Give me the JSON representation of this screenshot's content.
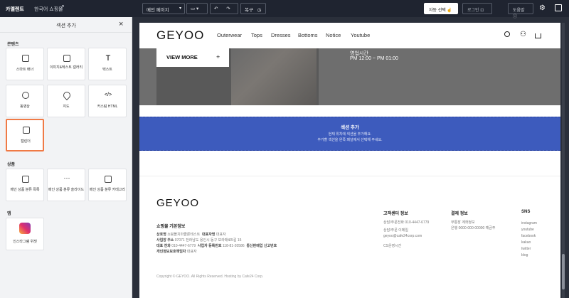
{
  "topbar": {
    "brand": "카멜렌트",
    "shop": "한국어 쇼핑몰",
    "page_select": "메인 페이지",
    "restore_label": "복구",
    "auto_select_label": "자동 선택",
    "login_label": "로그인",
    "help_label": "도움말"
  },
  "panel": {
    "title": "섹션 추가",
    "categories": {
      "content": "콘텐츠",
      "product": "상품",
      "app": "앱"
    },
    "content_tiles": [
      "스마트 배너",
      "이미지&텍스트 갤러리",
      "텍스트",
      "동영상",
      "지도",
      "커스텀 HTML",
      "캘린더"
    ],
    "product_tiles": [
      "메인 상품 분류 목록",
      "메인 상품 분류 슬라이드",
      "메인 상품 분류 카테고리"
    ],
    "app_tiles": [
      "인스타그램 위젯"
    ]
  },
  "site": {
    "logo": "GEYOO",
    "nav": [
      "Outerwear",
      "Tops",
      "Dresses",
      "Bottoms",
      "Notice",
      "Youtube"
    ],
    "hero": {
      "view_more": "VIEW MORE",
      "plus": "+",
      "hours_label": "영업시간",
      "hours": "PM 12:00 ~ PM 01:00"
    },
    "add_section": {
      "title": "섹션 추가",
      "line1": "현재 위치에 섹션을 추가해요.",
      "line2": "추가할 섹션을 왼쪽 패널에서 선택해 주세요."
    },
    "footer": {
      "logo": "GEYOO",
      "info_title": "쇼핑몰 기본정보",
      "lines": [
        {
          "label": "상호명",
          "value": "쇼핑몰치마클론테스트"
        },
        {
          "label": "대표자명",
          "value": "대표자"
        },
        {
          "label": "사업장 주소",
          "value": "07071 전라남도 용인시 동구 보라매로5길 15"
        },
        {
          "label": "대표 전화",
          "value": "010-4447-6779"
        },
        {
          "label": "사업자 등록번호",
          "value": "118-81-20586"
        },
        {
          "label": "통신판매업 신고번호",
          "value": ""
        },
        {
          "label": "개인정보보호책임자",
          "value": "대표자"
        }
      ],
      "cs_title": "고객센터 정보",
      "cs_lines": [
        "상담/주문전화  010-4447-6779",
        "상담/주문 이메일",
        "geyoo@cafe24corp.com",
        "CS운영시간"
      ],
      "pay_title": "결제 정보",
      "pay_lines": [
        "무통장 계좌정보",
        "은행  0000-000-00000  예금주"
      ],
      "sns_title": "SNS",
      "sns": [
        "instagram",
        "youtube",
        "facebook",
        "kakao",
        "twitter",
        "blog"
      ],
      "copyright": "Copyright © GEYOO. All Rights Reserved. Hosting by Cafe24 Corp."
    }
  }
}
